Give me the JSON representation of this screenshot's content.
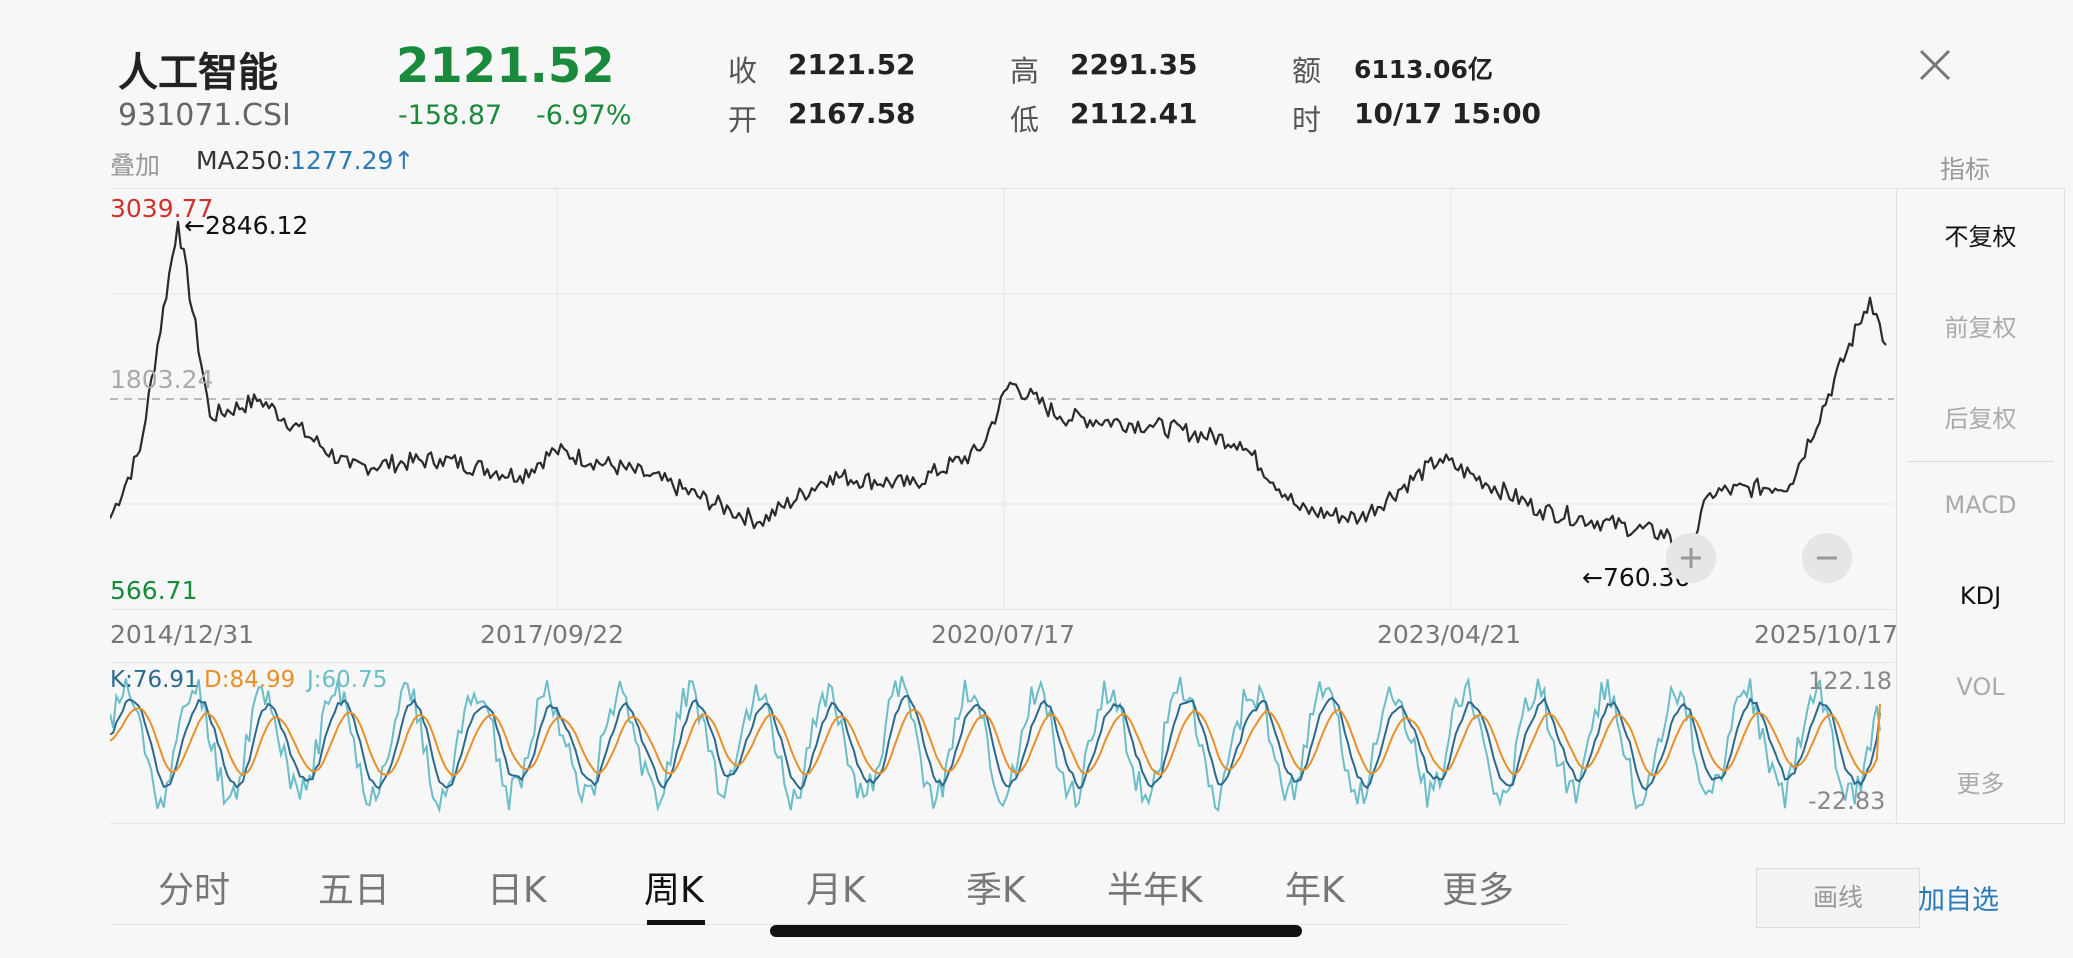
{
  "header": {
    "name": "人工智能",
    "code": "931071.CSI",
    "price": "2121.52",
    "change": "-158.87",
    "change_pct": "-6.97%",
    "quote": {
      "close_label": "收",
      "close": "2121.52",
      "open_label": "开",
      "open": "2167.58",
      "high_label": "高",
      "high": "2291.35",
      "low_label": "低",
      "low": "2112.41",
      "amount_label": "额",
      "amount": "6113.06亿",
      "time_label": "时",
      "time": "10/17 15:00"
    }
  },
  "overlay": {
    "label": "叠加",
    "ma_name": "MA250:",
    "ma_value": "1277.29↑",
    "indicator_title": "指标"
  },
  "main_chart": {
    "y_high": "3039.77",
    "y_low": "566.71",
    "y_mid": "1803.24",
    "max_marker": "←2846.12",
    "min_marker": "←760.36",
    "x_labels": [
      "2014/12/31",
      "2017/09/22",
      "2020/07/17",
      "2023/04/21",
      "2025/10/17"
    ],
    "zoom_in": "+",
    "zoom_out": "−"
  },
  "kdj": {
    "k": "K:76.91",
    "d": "D:84.99",
    "j": "J:60.75",
    "max": "122.18",
    "min": "-22.83"
  },
  "side_menu": [
    "不复权",
    "前复权",
    "后复权",
    "MACD",
    "KDJ",
    "VOL",
    "更多"
  ],
  "side_menu_active": [
    "不复权",
    "KDJ"
  ],
  "tabs": [
    "分时",
    "五日",
    "日K",
    "周K",
    "月K",
    "季K",
    "半年K",
    "年K",
    "更多"
  ],
  "active_tab": "周K",
  "actions": {
    "draw": "画线",
    "add_fav": "加自选"
  },
  "colors": {
    "up_red": "#d0302e",
    "down_green": "#1a8a3c",
    "accent_blue": "#2a7ab8",
    "k_line": "#2b6a8f",
    "d_line": "#e8902a",
    "j_line": "#6bbdc8"
  },
  "chart_data": [
    {
      "type": "line",
      "x": [
        "2014/12/31",
        "2015/03",
        "2015/06",
        "2015/09",
        "2015/12",
        "2016/06",
        "2016/12",
        "2017/06",
        "2017/09/22",
        "2017/12",
        "2018/06",
        "2018/12",
        "2019/06",
        "2019/12",
        "2020/03",
        "2020/07/17",
        "2020/12",
        "2021/06",
        "2021/12",
        "2022/06",
        "2022/12",
        "2023/04/21",
        "2023/12",
        "2024/06",
        "2024/09",
        "2024/12",
        "2025/06",
        "2025/09",
        "2025/10/17"
      ],
      "series": [
        {
          "values": [
            1100,
            1500,
            2846,
            1700,
            1800,
            1400,
            1450,
            1350,
            1500,
            1350,
            1150,
            1080,
            1350,
            1300,
            1500,
            1900,
            1700,
            1650,
            1550,
            1150,
            1100,
            1450,
            1150,
            1000,
            760,
            1250,
            1300,
            2400,
            2121
          ]
        }
      ],
      "ylim": [
        566.71,
        3039.77
      ],
      "reference_line": 1803.24,
      "grid": true
    },
    {
      "type": "line",
      "x_range": [
        "2014/12/31",
        "2025/10/17"
      ],
      "series": [
        {
          "name": "K"
        },
        {
          "name": "D"
        },
        {
          "name": "J"
        }
      ],
      "last_values": {
        "K": 76.91,
        "D": 84.99,
        "J": 60.75
      },
      "ylim": [
        -22.83,
        122.18
      ]
    }
  ]
}
